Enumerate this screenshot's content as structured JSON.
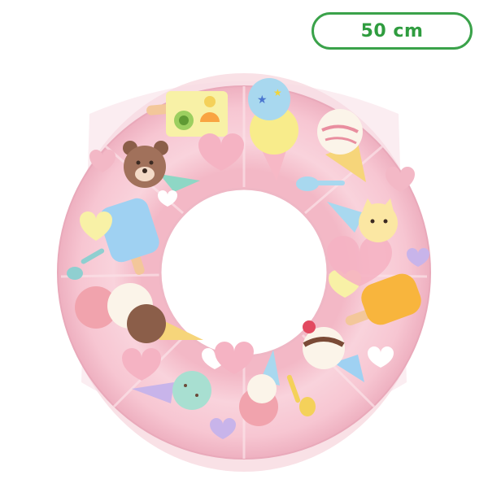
{
  "size_label": "50 cm",
  "product": {
    "description_icon": "ice-cream-swim-ring",
    "colors": {
      "ring": "#f7c9d3",
      "ring_shadow": "#eab1c0",
      "badge_border": "#3aa24a",
      "badge_text": "#2f9c3f"
    }
  }
}
